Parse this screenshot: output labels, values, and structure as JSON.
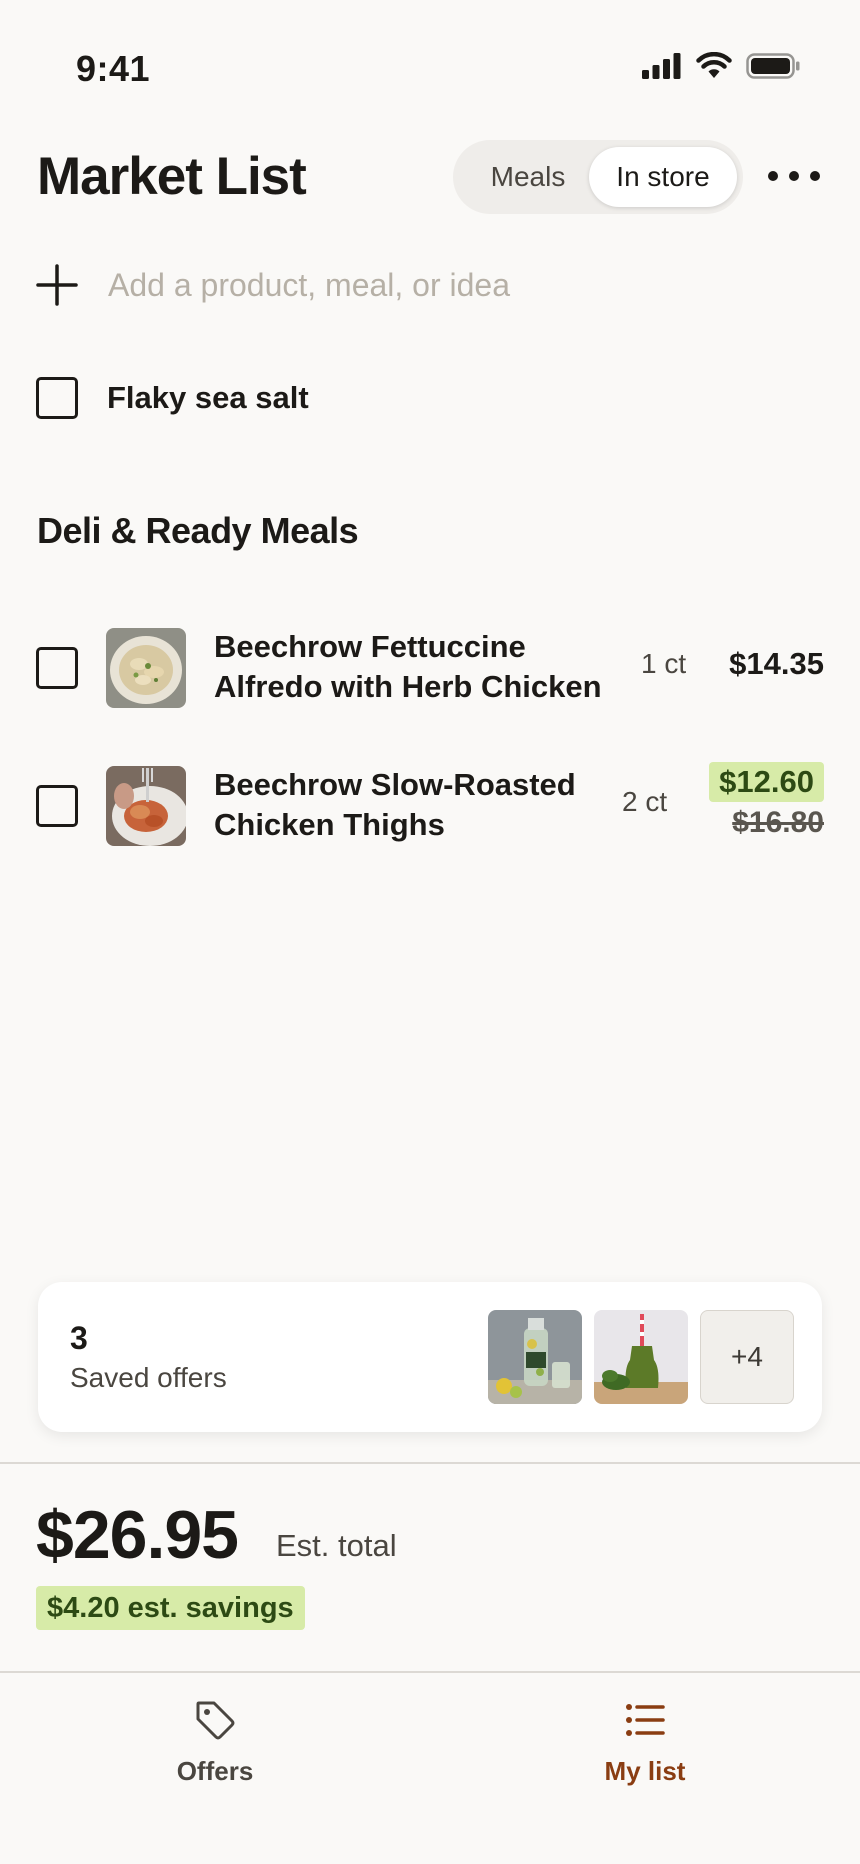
{
  "status_bar": {
    "time": "9:41"
  },
  "header": {
    "title": "Market List",
    "segments": [
      "Meals",
      "In store"
    ],
    "selected_segment": "In store"
  },
  "add_item": {
    "placeholder": "Add a product, meal, or idea",
    "value": ""
  },
  "loose_items": [
    {
      "label": "Flaky sea salt",
      "checked": false
    }
  ],
  "sections": [
    {
      "title": "Deli & Ready Meals",
      "items": [
        {
          "name_line1": "Beechrow Fettuccine",
          "name_line2": "Alfredo with Herb Chicken",
          "qty": "1 ct",
          "price": "$14.35",
          "checked": false
        },
        {
          "name_line1": "Beechrow Slow-Roasted",
          "name_line2": "Chicken Thighs",
          "qty": "2 ct",
          "sale_price": "$12.60",
          "original_price": "$16.80",
          "checked": false
        }
      ]
    }
  ],
  "saved_offers": {
    "count": "3",
    "label": "Saved offers",
    "more": "+4"
  },
  "summary": {
    "total": "$26.95",
    "total_label": "Est. total",
    "savings": "$4.20 est. savings"
  },
  "tabbar": {
    "tabs": [
      {
        "label": "Offers",
        "icon": "tag-icon"
      },
      {
        "label": "My list",
        "icon": "list-icon"
      }
    ],
    "active": "My list"
  },
  "colors": {
    "accent": "#8a3d12",
    "savings_bg": "#d7eba8",
    "background": "#faf9f7"
  }
}
